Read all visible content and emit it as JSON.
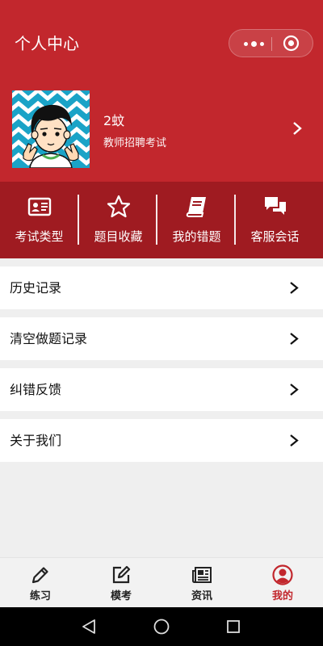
{
  "header": {
    "title": "个人中心",
    "capsule": {
      "more_icon": "more-dots-icon",
      "close_icon": "mini-program-close-icon"
    },
    "bg_color": "#c2272d"
  },
  "profile": {
    "name": "2蚊",
    "subtitle": "教师招聘考试",
    "avatar_icon": "cartoon-avatar-icon"
  },
  "quick_nav": {
    "bg_color": "#9f1b21",
    "items": [
      {
        "label": "考试类型",
        "icon": "id-card-icon"
      },
      {
        "label": "题目收藏",
        "icon": "star-icon"
      },
      {
        "label": "我的错题",
        "icon": "book-icon"
      },
      {
        "label": "客服会话",
        "icon": "chat-bubbles-icon"
      }
    ]
  },
  "menu": [
    {
      "label": "历史记录"
    },
    {
      "label": "清空做题记录"
    },
    {
      "label": "纠错反馈"
    },
    {
      "label": "关于我们"
    }
  ],
  "tabbar": {
    "active_color": "#c2272d",
    "items": [
      {
        "label": "练习",
        "icon": "pencil-icon"
      },
      {
        "label": "模考",
        "icon": "edit-square-icon"
      },
      {
        "label": "资讯",
        "icon": "newspaper-icon"
      },
      {
        "label": "我的",
        "icon": "user-circle-icon",
        "active": true
      }
    ]
  }
}
